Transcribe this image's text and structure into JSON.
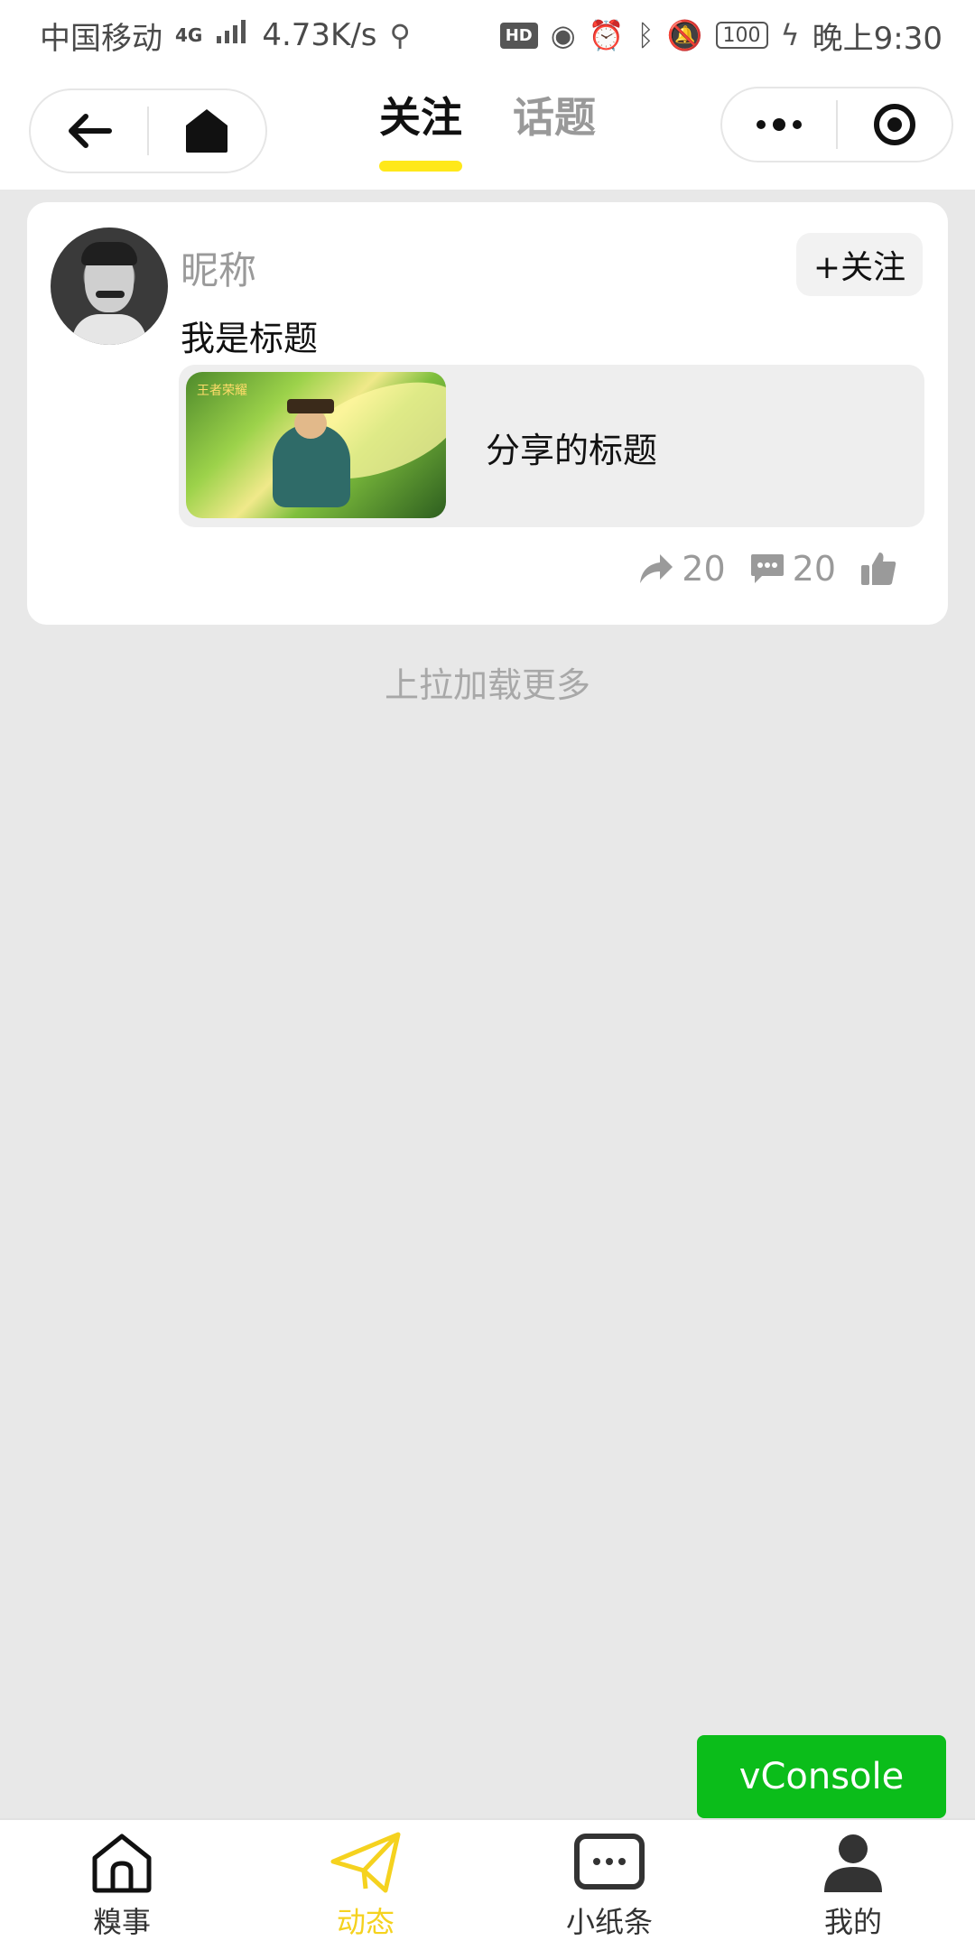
{
  "status_bar": {
    "carrier": "中国移动",
    "network": "4G",
    "speed": "4.73K/s",
    "hd": "HD",
    "battery": "100",
    "time": "晚上9:30"
  },
  "header": {
    "tabs": [
      {
        "label": "关注",
        "active": true
      },
      {
        "label": "话题",
        "active": false
      }
    ]
  },
  "feed": {
    "post": {
      "nickname": "昵称",
      "follow_label": "+关注",
      "title": "我是标题",
      "share_title": "分享的标题",
      "thumb_logo": "王者荣耀",
      "share_count": "20",
      "comment_count": "20"
    },
    "load_more": "上拉加载更多"
  },
  "vconsole_label": "vConsole",
  "tabbar": {
    "items": [
      {
        "label": "糗事",
        "icon": "home-icon",
        "active": false
      },
      {
        "label": "动态",
        "icon": "paper-plane-icon",
        "active": true
      },
      {
        "label": "小纸条",
        "icon": "message-icon",
        "active": false
      },
      {
        "label": "我的",
        "icon": "user-icon",
        "active": false
      }
    ]
  },
  "colors": {
    "accent_yellow": "#ffe81a",
    "tab_active": "#f5d21f",
    "vconsole_green": "#0bbd1a",
    "background": "#e8e8e8"
  }
}
